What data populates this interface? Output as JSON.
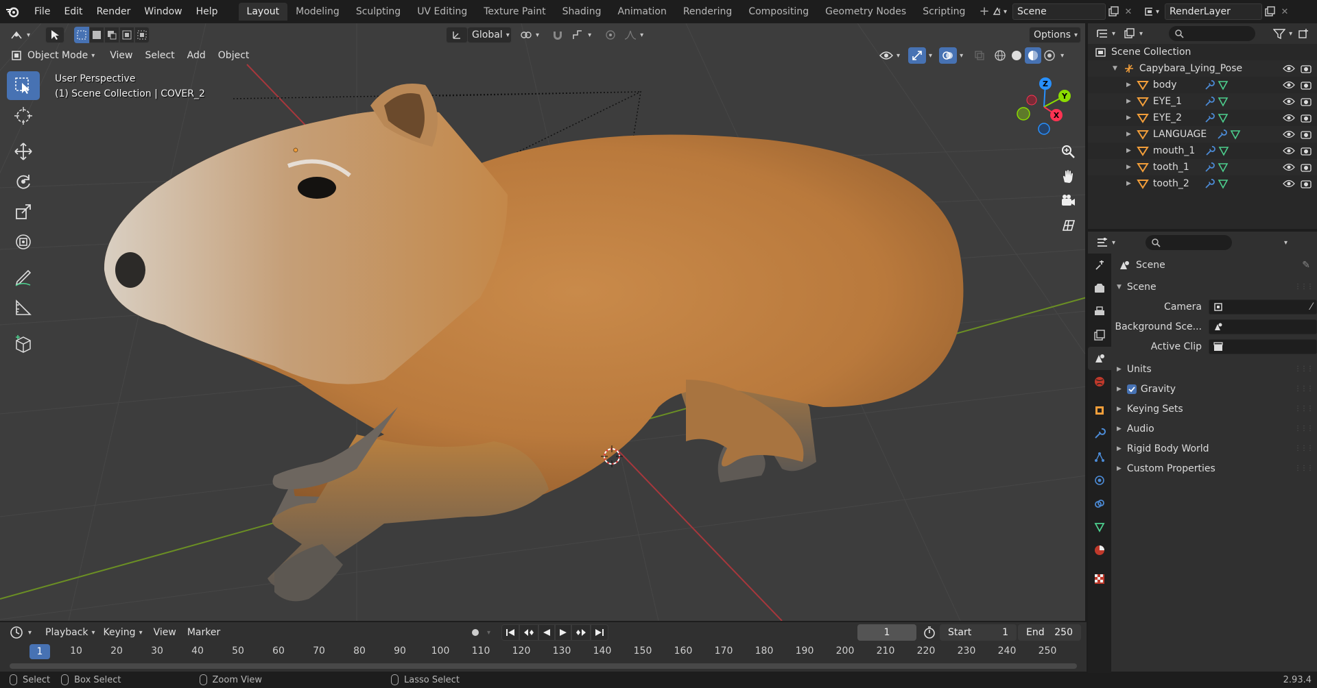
{
  "menu": [
    "File",
    "Edit",
    "Render",
    "Window",
    "Help"
  ],
  "workspaces": [
    {
      "label": "Layout",
      "active": true
    },
    {
      "label": "Modeling"
    },
    {
      "label": "Sculpting"
    },
    {
      "label": "UV Editing"
    },
    {
      "label": "Texture Paint"
    },
    {
      "label": "Shading"
    },
    {
      "label": "Animation"
    },
    {
      "label": "Rendering"
    },
    {
      "label": "Compositing"
    },
    {
      "label": "Geometry Nodes"
    },
    {
      "label": "Scripting"
    }
  ],
  "scene_name": "Scene",
  "render_layer": "RenderLayer",
  "viewport": {
    "mode": "Object Mode",
    "menus": [
      "View",
      "Select",
      "Add",
      "Object"
    ],
    "orientation": "Global",
    "options": "Options",
    "info_line1": "User Perspective",
    "info_line2": "(1) Scene Collection | COVER_2",
    "gizmo_axes": {
      "x": "X",
      "y": "Y",
      "z": "Z"
    }
  },
  "timeline": {
    "menus": [
      "Playback",
      "Keying",
      "View",
      "Marker"
    ],
    "current_frame": "1",
    "start_label": "Start",
    "start": "1",
    "end_label": "End",
    "end": "250",
    "ruler": [
      "10",
      "20",
      "30",
      "40",
      "50",
      "60",
      "70",
      "80",
      "90",
      "100",
      "110",
      "120",
      "130",
      "140",
      "150",
      "160",
      "170",
      "180",
      "190",
      "200",
      "210",
      "220",
      "230",
      "240",
      "250"
    ],
    "ruler_current": "1"
  },
  "status": {
    "select": "Select",
    "box_select": "Box Select",
    "zoom_view": "Zoom View",
    "lasso_select": "Lasso Select",
    "version": "2.93.4"
  },
  "outliner": {
    "root": "Scene Collection",
    "parent": "Capybara_Lying_Pose",
    "children": [
      "body",
      "EYE_1",
      "EYE_2",
      "LANGUAGE",
      "mouth_1",
      "tooth_1",
      "tooth_2"
    ]
  },
  "properties": {
    "context": "Scene",
    "panel": "Scene",
    "fields": [
      {
        "label": "Camera",
        "value": ""
      },
      {
        "label": "Background Sce...",
        "value": ""
      },
      {
        "label": "Active Clip",
        "value": ""
      }
    ],
    "subpanels": [
      "Units",
      "Gravity",
      "Keying Sets",
      "Audio",
      "Rigid Body World",
      "Custom Properties"
    ],
    "gravity_checked": true
  },
  "colors": {
    "accent": "#4772b3",
    "axis_x": "#ff3352",
    "axis_y": "#8bdc00",
    "axis_z": "#2890ff",
    "object_icon": "#f29e3a",
    "mesh_icon": "#4dcf8e"
  }
}
